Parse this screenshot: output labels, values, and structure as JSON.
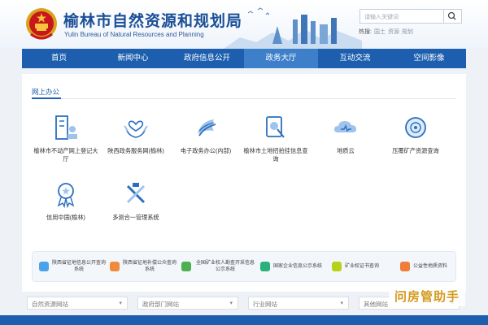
{
  "header": {
    "title": "榆林市自然资源和规划局",
    "subtitle": "Yulin Bureau of Natural Resources and Planning",
    "search_placeholder": "请输入关键词",
    "hot_label": "热搜:",
    "hot_words": [
      "国土",
      "资源",
      "规划"
    ]
  },
  "nav": {
    "items": [
      {
        "label": "首页"
      },
      {
        "label": "新闻中心"
      },
      {
        "label": "政府信息公开"
      },
      {
        "label": "政务大厅"
      },
      {
        "label": "互动交流"
      },
      {
        "label": "空间影像"
      }
    ],
    "active_index": 3
  },
  "section": {
    "title": "网上办公"
  },
  "services": [
    {
      "label": "榆林市不动产网上登记大厅",
      "icon": "building-icon"
    },
    {
      "label": "陕西政务服务网(榆林)",
      "icon": "hands-heart-icon"
    },
    {
      "label": "电子政务办公(内部)",
      "icon": "document-flow-icon"
    },
    {
      "label": "榆林市土地招拍挂信息查询",
      "icon": "land-search-icon"
    },
    {
      "label": "地质云",
      "icon": "cloud-icon"
    },
    {
      "label": "压覆矿产资源查询",
      "icon": "mineral-search-icon"
    },
    {
      "label": "信用中国(榆林)",
      "icon": "credit-medal-icon"
    },
    {
      "label": "多测合一管理系统",
      "icon": "survey-tools-icon"
    }
  ],
  "bottom_links": [
    {
      "label": "陕西省征地信息公开查询系统",
      "color": "#4aa3e8"
    },
    {
      "label": "陕西省征地补偿公众查询系统",
      "color": "#f08a3c"
    },
    {
      "label": "全国矿业权人勘查开采信息公示系统",
      "color": "#4caf50"
    },
    {
      "label": "国家企业信息公示系统",
      "color": "#2ab07a"
    },
    {
      "label": "矿业权证书查询",
      "color": "#b7d11b"
    },
    {
      "label": "公益性地质资料",
      "color": "#ef7d3b"
    }
  ],
  "footer_links": [
    {
      "label": "自然资源网站"
    },
    {
      "label": "政府部门网站"
    },
    {
      "label": "行业网站"
    },
    {
      "label": "其他网站"
    }
  ],
  "watermark": "问房管助手",
  "colors": {
    "primary": "#1d5fae",
    "nav_active": "#3e7fc9",
    "title": "#1a4f97"
  }
}
